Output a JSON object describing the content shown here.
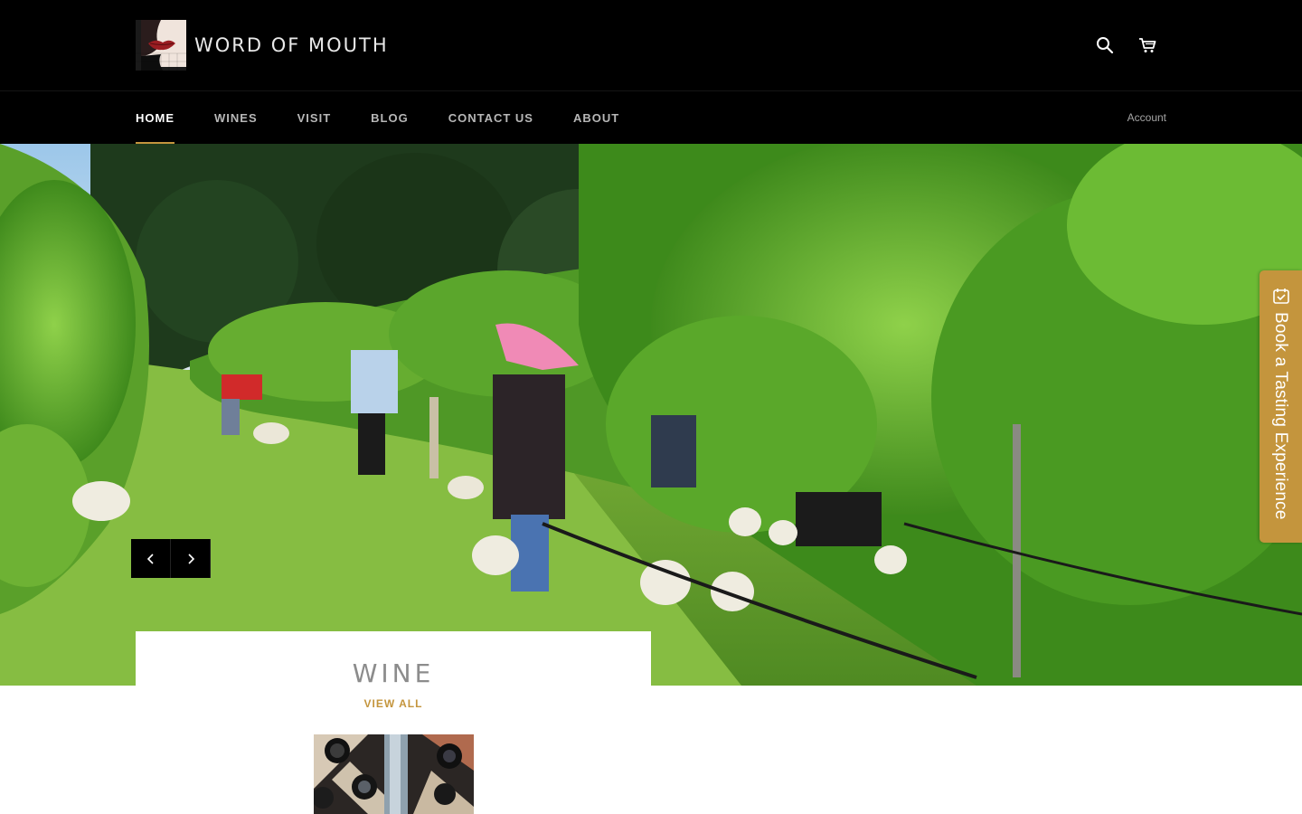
{
  "header": {
    "brand_name": "WORD OF MOUTH",
    "logo_icon": "lips-portrait-logo",
    "search_icon": "search-icon",
    "cart_icon": "cart-icon"
  },
  "nav": {
    "items": [
      {
        "label": "HOME",
        "active": true
      },
      {
        "label": "WINES",
        "active": false
      },
      {
        "label": "VISIT",
        "active": false
      },
      {
        "label": "BLOG",
        "active": false
      },
      {
        "label": "CONTACT US",
        "active": false
      },
      {
        "label": "ABOUT",
        "active": false
      }
    ],
    "account_label": "Account"
  },
  "hero": {
    "image_description_icon": "vineyard-harvest-photo",
    "prev_icon": "chevron-left-icon",
    "next_icon": "chevron-right-icon"
  },
  "tasting_tab": {
    "label": "Book a Tasting Experience",
    "icon": "calendar-icon"
  },
  "collection": {
    "title": "WINE",
    "view_all": "VIEW ALL",
    "image_icon": "wine-bottles-photo"
  },
  "colors": {
    "accent": "#c4953d",
    "header_bg": "#000000",
    "nav_text": "#b7b7b7",
    "title_text": "#8c8c8c"
  }
}
